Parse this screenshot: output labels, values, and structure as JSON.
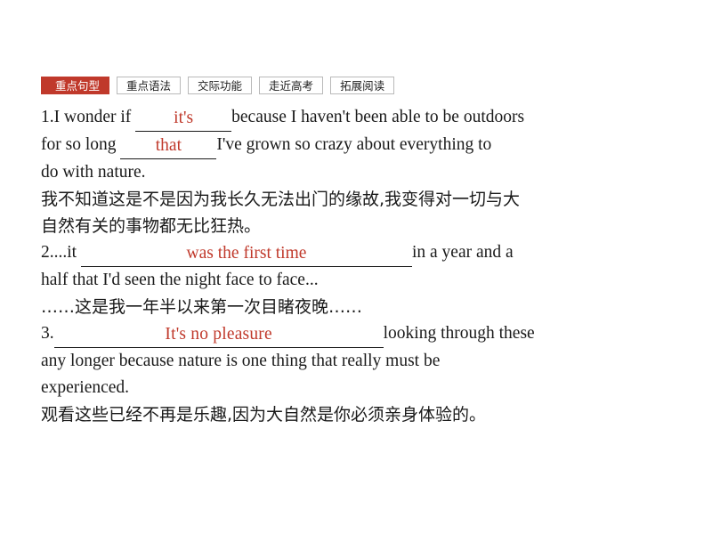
{
  "tabs": [
    {
      "label": "重点句型",
      "active": true
    },
    {
      "label": "重点语法",
      "active": false
    },
    {
      "label": "交际功能",
      "active": false
    },
    {
      "label": "走近高考",
      "active": false
    },
    {
      "label": "拓展阅读",
      "active": false
    }
  ],
  "colors": {
    "accent": "#c0392b",
    "text": "#1a1a1a",
    "tab_border": "#b9b9b9"
  },
  "items": [
    {
      "num": "1.",
      "line1_pre": "1.I wonder if ",
      "answer1": "it's",
      "line1_post": "because I haven't been able to be outdoors",
      "line2_pre": "for so long ",
      "answer2": "that",
      "line2_post": "I've grown so crazy about everything to",
      "line3": "do with nature.",
      "cn_line1": "我不知道这是不是因为我长久无法出门的缘故,我变得对一切与大",
      "cn_line2": "自然有关的事物都无比狂热。"
    },
    {
      "num": "2.",
      "line1_pre": "2....it ",
      "answer1": "was the first time",
      "line1_post": "in a year and a",
      "line2": "half that I'd seen the night face to face...",
      "cn_line1": "……这是我一年半以来第一次目睹夜晚……"
    },
    {
      "num": "3.",
      "line1_pre": "3.",
      "answer1": "It's no pleasure",
      "line1_post": "looking through these",
      "line2": "any longer because nature is one thing that really must be",
      "line3": "experienced.",
      "cn_line1": "观看这些已经不再是乐趣,因为大自然是你必须亲身体验的。"
    }
  ]
}
